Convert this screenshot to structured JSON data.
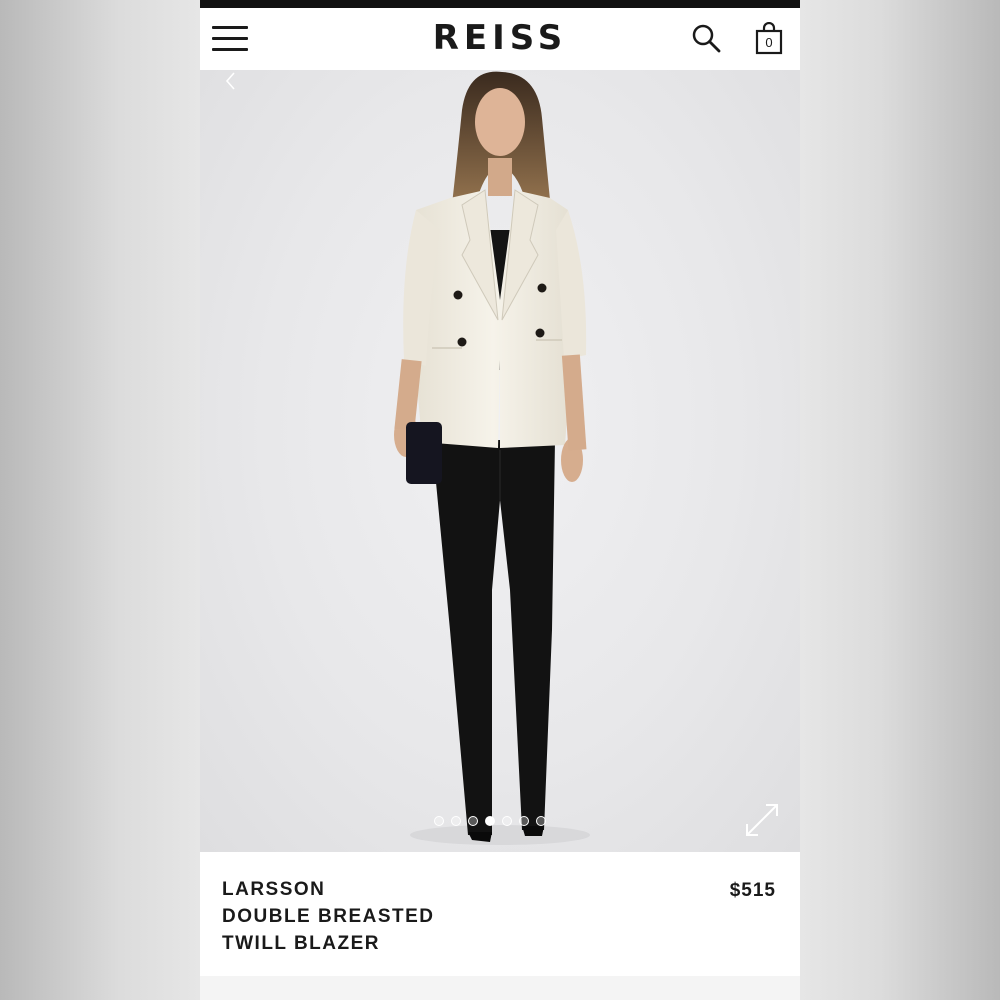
{
  "header": {
    "brand": "REISS",
    "bag_count": "0",
    "icons": [
      "menu-icon",
      "search-icon",
      "bag-icon"
    ]
  },
  "gallery": {
    "image_count": 7,
    "active_index": 3,
    "image_alt": "Model wearing white double breasted twill blazer with black trousers",
    "icons": [
      "chevron-left-icon",
      "expand-icon"
    ]
  },
  "product": {
    "name_line1": "LARSSON",
    "name_line2": "DOUBLE BREASTED",
    "name_line3": "TWILL BLAZER",
    "price": "$515"
  },
  "colors": {
    "text": "#1a1a1a",
    "blazer": "#f1ede2",
    "trousers": "#111111"
  }
}
